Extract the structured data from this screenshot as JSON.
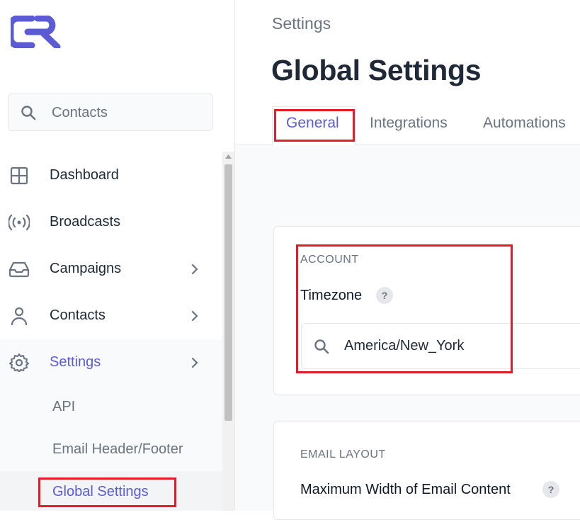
{
  "sidebar": {
    "search": {
      "text": "Contacts"
    },
    "items": [
      {
        "label": "Dashboard",
        "icon": "grid-icon"
      },
      {
        "label": "Broadcasts",
        "icon": "broadcast-icon"
      },
      {
        "label": "Campaigns",
        "icon": "inbox-icon"
      },
      {
        "label": "Contacts",
        "icon": "user-icon"
      },
      {
        "label": "Settings",
        "icon": "gear-icon"
      }
    ],
    "sub_items": [
      {
        "label": "API"
      },
      {
        "label": "Email Header/Footer"
      },
      {
        "label": "Global Settings"
      }
    ]
  },
  "header": {
    "breadcrumb": "Settings",
    "title": "Global Settings"
  },
  "tabs": [
    {
      "label": "General"
    },
    {
      "label": "Integrations"
    },
    {
      "label": "Automations"
    }
  ],
  "account": {
    "section": "ACCOUNT",
    "timezone_label": "Timezone",
    "timezone_value": "America/New_York",
    "help": "?"
  },
  "email_layout": {
    "section": "EMAIL LAYOUT",
    "max_width_label": "Maximum Width of Email Content",
    "help": "?"
  },
  "colors": {
    "accent": "#5b5bd6",
    "highlight": "#e11d2a"
  }
}
